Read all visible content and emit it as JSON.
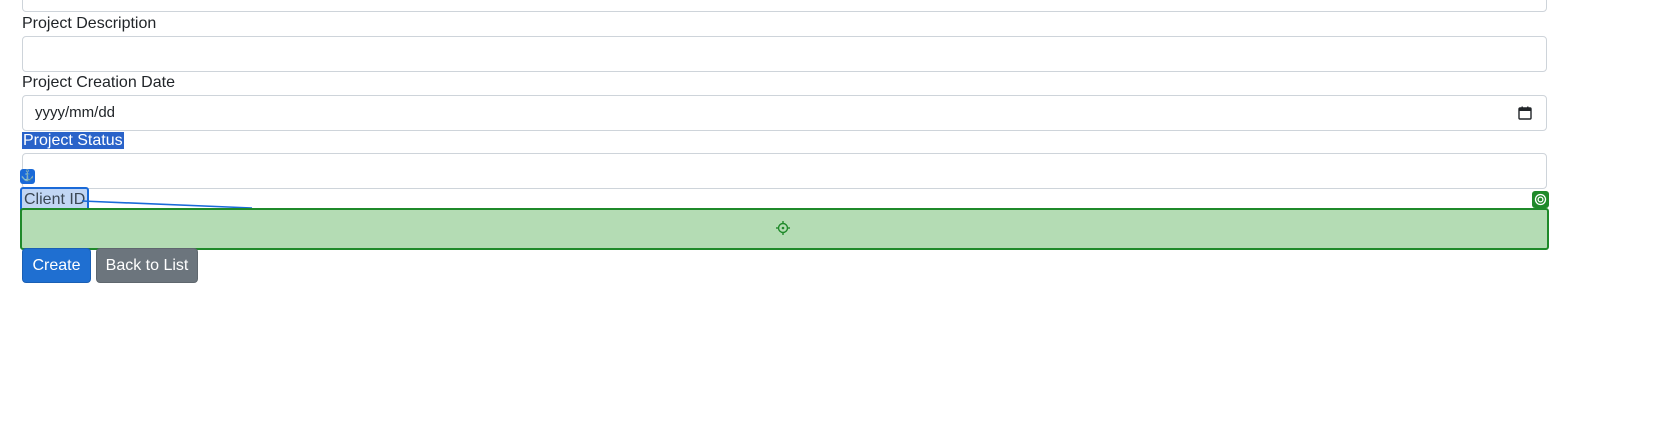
{
  "form": {
    "description_label": "Project Description",
    "description_value": "",
    "creation_date_label": "Project Creation Date",
    "creation_date_placeholder": "yyyy/mm/dd",
    "status_label": "Project Status",
    "status_value": "",
    "client_id_label": "Client ID",
    "client_id_value": ""
  },
  "buttons": {
    "create_label": "Create",
    "back_label": "Back to List"
  },
  "overlay": {
    "anchor_icon": "anchor-icon",
    "target_icon": "target-icon",
    "crosshair_icon": "crosshair-icon",
    "source_color": "#1a6ad8",
    "target_color": "#1f8a2a"
  }
}
